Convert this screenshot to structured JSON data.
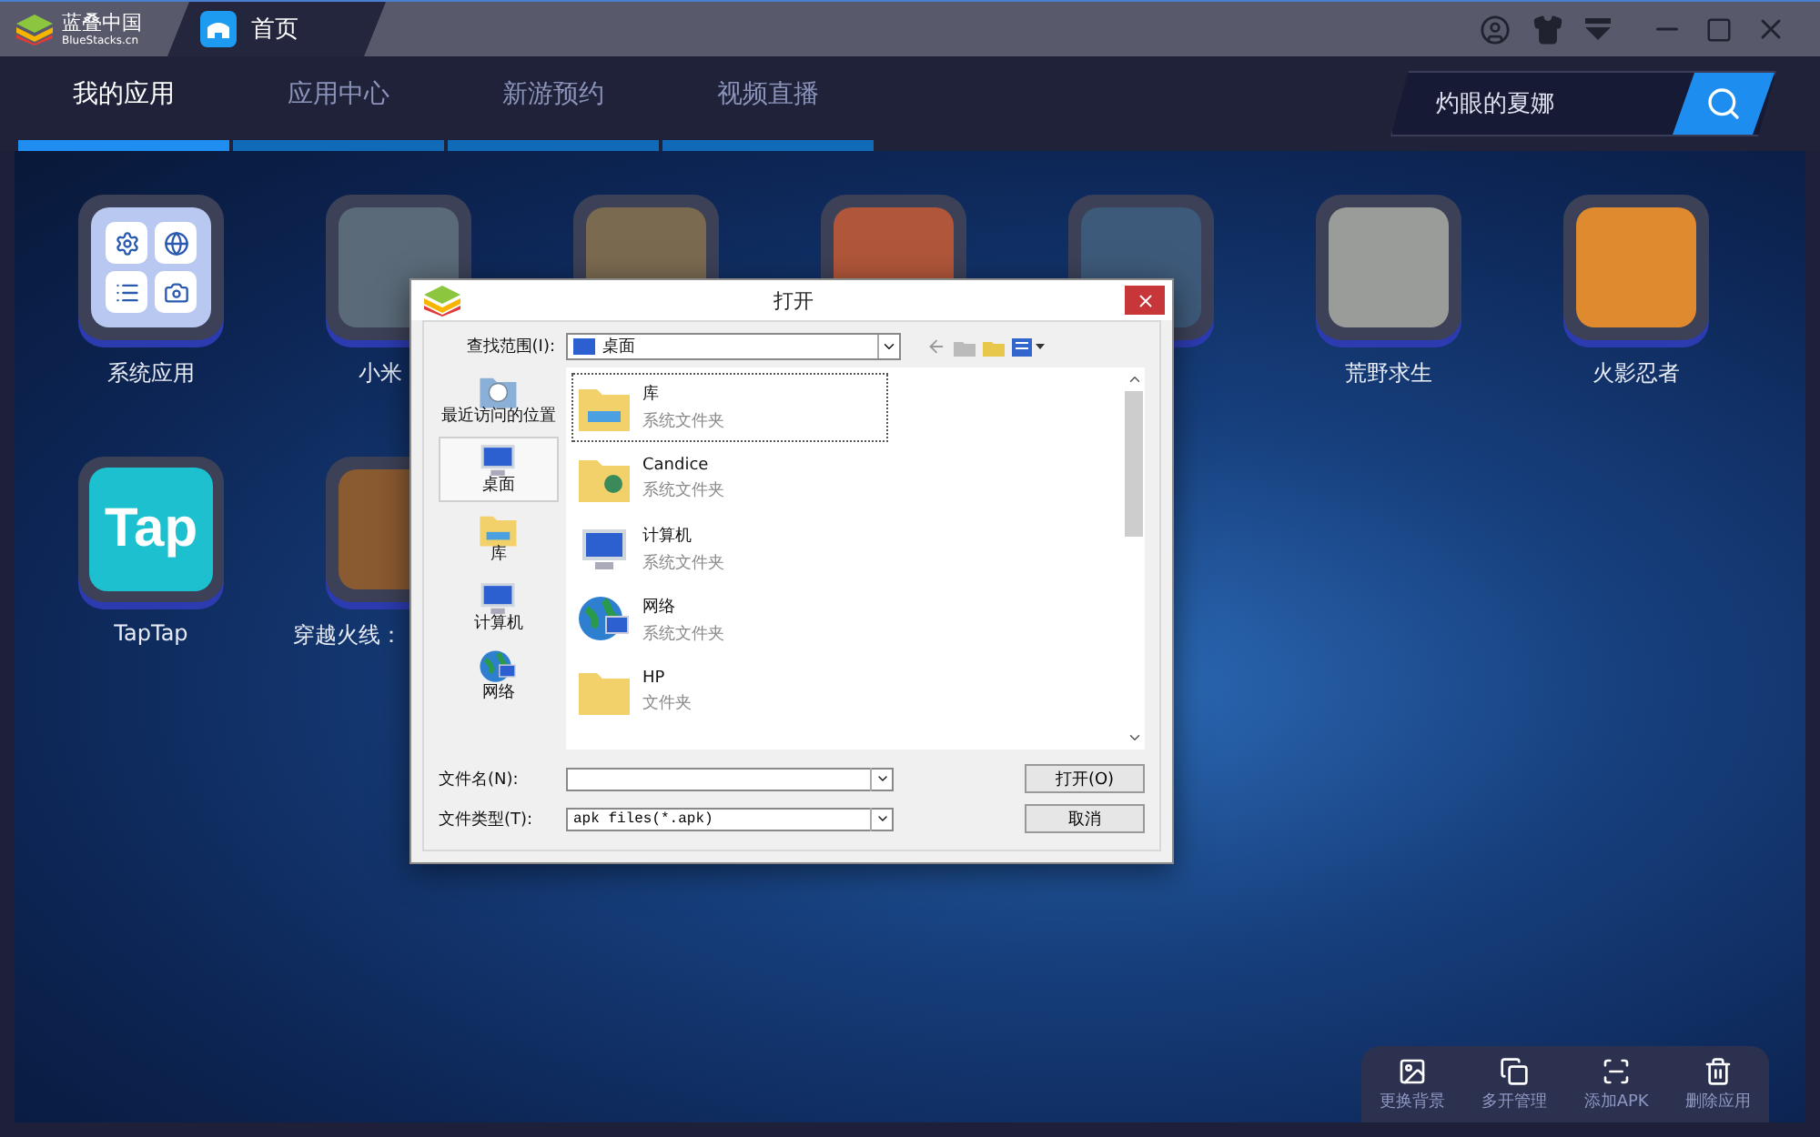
{
  "titlebar": {
    "brand": "蓝叠中国",
    "brand_sub": "BlueStacks.cn",
    "tab": "首页"
  },
  "nav": {
    "tabs": [
      {
        "label": "我的应用",
        "selected": true
      },
      {
        "label": "应用中心",
        "selected": false
      },
      {
        "label": "新游预约",
        "selected": false
      },
      {
        "label": "视频直播",
        "selected": false
      }
    ],
    "search": {
      "value": "灼眼的夏娜"
    }
  },
  "apps": [
    {
      "kind": "system",
      "label": "系统应用",
      "color": "#b8c8f0"
    },
    {
      "kind": "photo",
      "label": "小米",
      "label_cut": true,
      "color": "#5a6a78"
    },
    {
      "kind": "photo",
      "color": "#7a6a50"
    },
    {
      "kind": "photo",
      "color": "#b0563a"
    },
    {
      "kind": "photo",
      "color": "#3e5a7a"
    },
    {
      "kind": "photo",
      "label": "荒野求生",
      "color": "#9a9c9a"
    },
    {
      "kind": "photo",
      "label": "火影忍者",
      "color": "#e08a30"
    },
    {
      "kind": "tap",
      "label": "TapTap",
      "logo_text": "Tap",
      "color": "#1cc0cf"
    },
    {
      "kind": "photo",
      "label": "穿越火线：",
      "label_cut": true,
      "color": "#8a5a30"
    }
  ],
  "dialog": {
    "title": "打开",
    "look_in_label": "查找范围(I):",
    "look_in_value": "桌面",
    "places": [
      {
        "kind": "recent",
        "label": "最近访问的位置",
        "selected": false
      },
      {
        "kind": "desktop",
        "label": "桌面",
        "selected": true
      },
      {
        "kind": "library",
        "label": "库",
        "selected": false
      },
      {
        "kind": "computer",
        "label": "计算机",
        "selected": false
      },
      {
        "kind": "network",
        "label": "网络",
        "selected": false
      }
    ],
    "files": [
      {
        "kind": "library",
        "name": "库",
        "type": "系统文件夹",
        "selected": true
      },
      {
        "kind": "user",
        "name": "Candice",
        "type": "系统文件夹",
        "selected": false
      },
      {
        "kind": "computer",
        "name": "计算机",
        "type": "系统文件夹",
        "selected": false
      },
      {
        "kind": "network",
        "name": "网络",
        "type": "系统文件夹",
        "selected": false
      },
      {
        "kind": "folder",
        "name": "HP",
        "type": "文件夹",
        "selected": false
      }
    ],
    "filename_label": "文件名(N):",
    "filetype_label": "文件类型(T):",
    "filetype_value": "apk files(*.apk)",
    "open_button": "打开(O)",
    "cancel_button": "取消"
  },
  "toolbar": [
    {
      "kind": "background",
      "label": "更换背景"
    },
    {
      "kind": "multi",
      "label": "多开管理"
    },
    {
      "kind": "apk",
      "label": "添加APK"
    },
    {
      "kind": "delete",
      "label": "删除应用"
    }
  ]
}
